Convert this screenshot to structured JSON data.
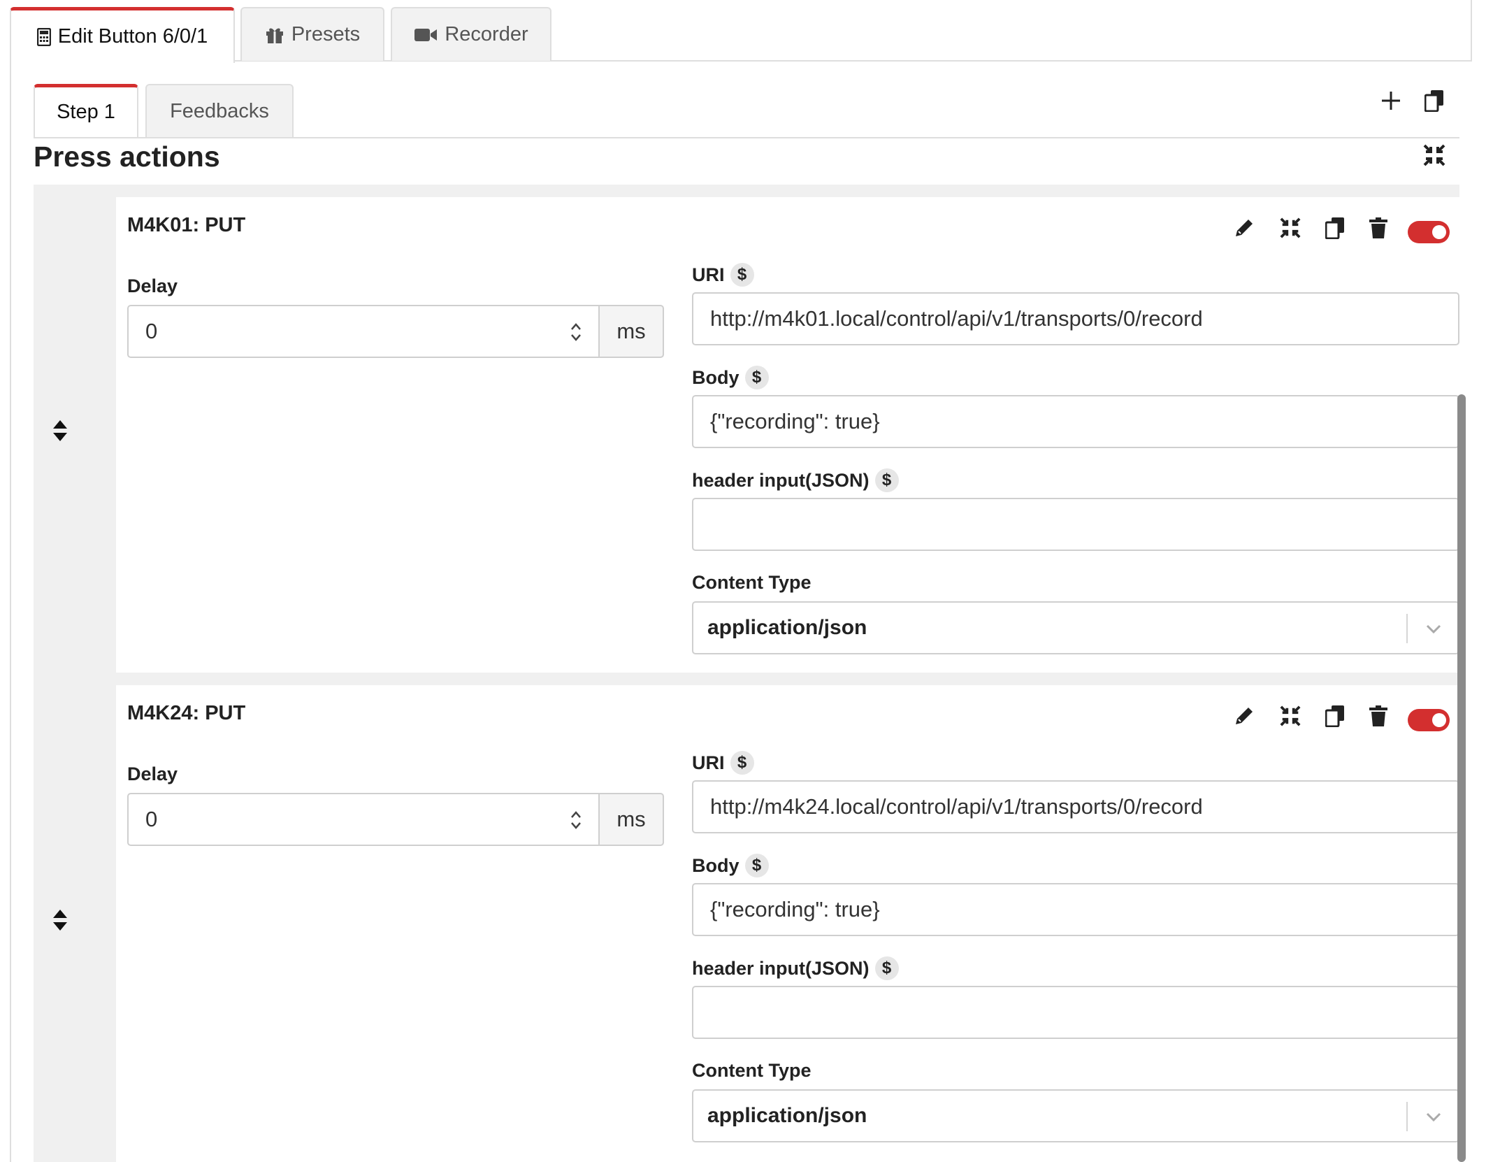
{
  "top_tabs": [
    {
      "label": "Edit Button 6/0/1",
      "icon": "calculator-icon",
      "active": true
    },
    {
      "label": "Presets",
      "icon": "gift-icon",
      "active": false
    },
    {
      "label": "Recorder",
      "icon": "video-camera-icon",
      "active": false
    }
  ],
  "sub_tabs": [
    {
      "label": "Step 1",
      "active": true
    },
    {
      "label": "Feedbacks",
      "active": false
    }
  ],
  "section": {
    "title": "Press actions"
  },
  "actions": [
    {
      "title": "M4K01: PUT",
      "delay_label": "Delay",
      "delay_value": "0",
      "delay_unit": "ms",
      "uri_label": "URI",
      "uri_value": "http://m4k01.local/control/api/v1/transports/0/record",
      "body_label": "Body",
      "body_value": "{\"recording\": true}",
      "header_label": "header input(JSON)",
      "header_value": "",
      "content_type_label": "Content Type",
      "content_type_value": "application/json",
      "variable_symbol": "$",
      "enabled": true
    },
    {
      "title": "M4K24: PUT",
      "delay_label": "Delay",
      "delay_value": "0",
      "delay_unit": "ms",
      "uri_label": "URI",
      "uri_value": "http://m4k24.local/control/api/v1/transports/0/record",
      "body_label": "Body",
      "body_value": "{\"recording\": true}",
      "header_label": "header input(JSON)",
      "header_value": "",
      "content_type_label": "Content Type",
      "content_type_value": "application/json",
      "variable_symbol": "$",
      "enabled": true
    }
  ],
  "colors": {
    "accent": "#d32f2f",
    "panel_bg": "#f0f0f0",
    "border": "#cfcfcf"
  }
}
